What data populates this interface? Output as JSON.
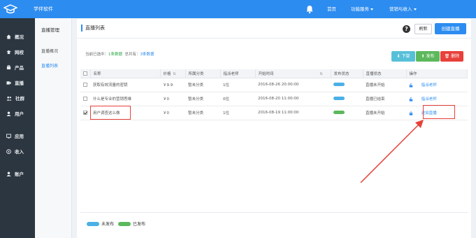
{
  "topbar": {
    "brand": "学伴软件",
    "nav": [
      {
        "label": "首页"
      },
      {
        "label": "功能服务"
      },
      {
        "label": "营销与收入"
      }
    ]
  },
  "sidebar": {
    "items": [
      {
        "label": "概况",
        "icon": "home-icon"
      },
      {
        "label": "网校",
        "icon": "school-icon"
      },
      {
        "label": "产品",
        "icon": "product-icon"
      },
      {
        "label": "直播",
        "icon": "live-icon"
      },
      {
        "label": "社群",
        "icon": "community-icon"
      },
      {
        "label": "用户",
        "icon": "user-icon"
      },
      {
        "label": "应用",
        "icon": "apps-icon"
      },
      {
        "label": "收入",
        "icon": "income-icon"
      },
      {
        "label": "账户",
        "icon": "account-icon"
      }
    ]
  },
  "subnav": {
    "title": "直播管理",
    "items": [
      {
        "label": "直播概况"
      },
      {
        "label": "直播列表"
      }
    ]
  },
  "main": {
    "title": "直播列表",
    "refresh_label": "刷新",
    "create_label": "创建直播",
    "stats": {
      "selected_prefix": "当前已选中：",
      "selected_value": "1条数据",
      "total_prefix": "总共有：",
      "total_value": "3条数据"
    },
    "actions": {
      "offline": "下架",
      "publish": "发布",
      "delete": "删除"
    },
    "table": {
      "headers": [
        "名称",
        "价格",
        "所属分类",
        "指派老师",
        "开始时间",
        "发布状态",
        "直播状态",
        "操作"
      ],
      "rows": [
        {
          "name": "获取有效流量的密钥",
          "price": "￥9.9",
          "category": "暂未分类",
          "teacher": "1位",
          "start": "2016-08-26 20:00:00",
          "status": "直播未开始",
          "op": "指派老师",
          "published": false,
          "checked": false
        },
        {
          "name": "什么是专业的营销思维",
          "price": "￥0",
          "category": "暂未分类",
          "teacher": "0位",
          "start": "2016-08-20 11:00:00",
          "status": "直播已结束",
          "op": "指派老师",
          "published": false,
          "checked": false
        },
        {
          "name": "用户调查这么做",
          "price": "￥0",
          "category": "暂未分类",
          "teacher": "1位",
          "start": "2016-08-19 11:00:00",
          "status": "直播未开始",
          "op": "进如直播",
          "published": true,
          "checked": true
        }
      ]
    },
    "legend": {
      "unpublished": "未发布",
      "published": "已发布"
    }
  },
  "colors": {
    "accent": "#2d8cf0",
    "unpublished": "#4ab0e6",
    "published": "#5cb85c",
    "offline": "#57c0d8",
    "publish": "#5cb85c",
    "delete": "#e8403a",
    "highlight": "#e8403a"
  }
}
